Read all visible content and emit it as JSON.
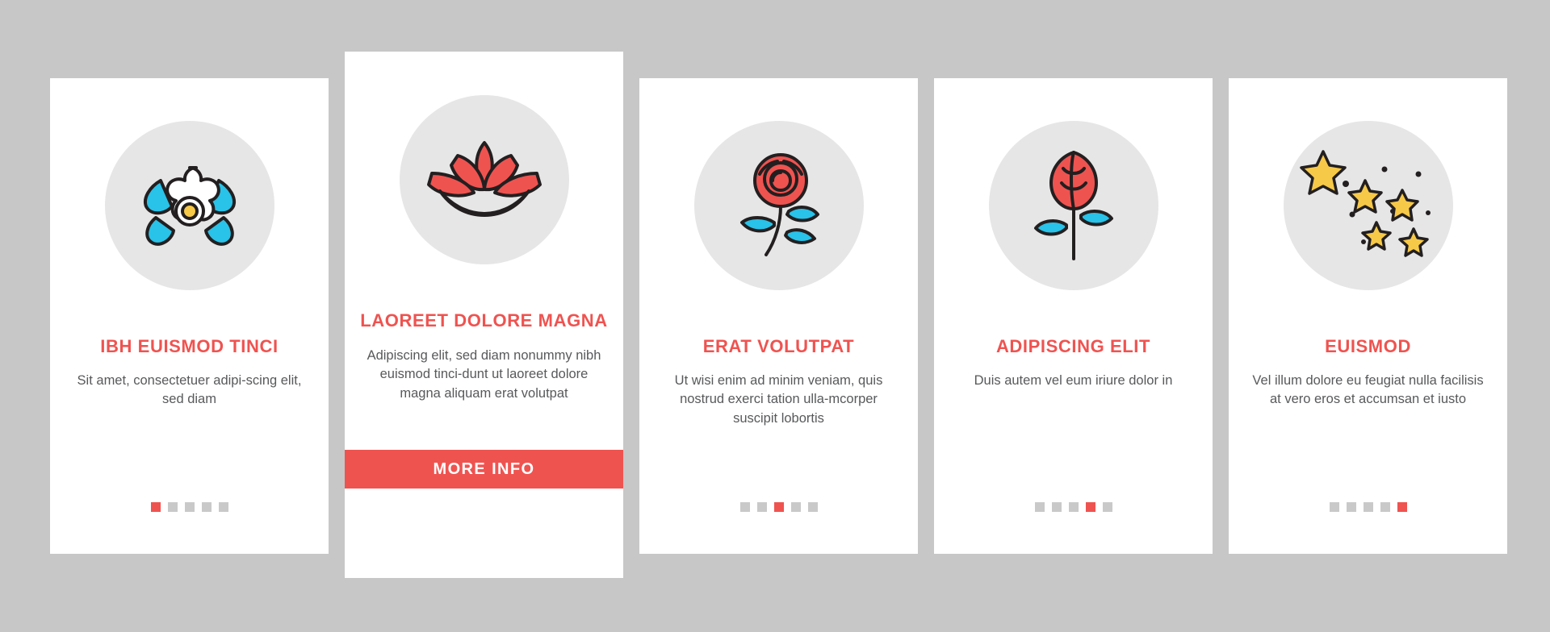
{
  "theme": {
    "background": "#c7c7c7",
    "card_background": "#ffffff",
    "accent": "#ef5350",
    "icon_circle": "#e6e6e6",
    "body_text": "#58595b",
    "dot_inactive": "#c9c9c9",
    "icon_yellow": "#f7c948",
    "icon_cyan": "#29c2e8",
    "icon_dark": "#231f20"
  },
  "cards": [
    {
      "id": "card-1",
      "icon": "flowers-icon",
      "title": "IBH EUISMOD TINCI",
      "body": "Sit amet, consectetuer adipi-scing elit, sed diam",
      "dots": {
        "count": 5,
        "active_index": 0
      },
      "featured": false
    },
    {
      "id": "card-2",
      "icon": "lotus-icon",
      "title": "LAOREET DOLORE MAGNA",
      "body": "Adipiscing elit, sed diam nonummy nibh euismod tinci-dunt ut laoreet dolore magna aliquam erat volutpat",
      "cta_label": "MORE INFO",
      "featured": true
    },
    {
      "id": "card-3",
      "icon": "rose-branch-icon",
      "title": "ERAT VOLUTPAT",
      "body": "Ut wisi enim ad minim veniam, quis nostrud exerci tation ulla-mcorper suscipit lobortis",
      "dots": {
        "count": 5,
        "active_index": 2
      },
      "featured": false
    },
    {
      "id": "card-4",
      "icon": "rosebud-icon",
      "title": "ADIPISCING ELIT",
      "body": "Duis autem vel eum iriure dolor in",
      "dots": {
        "count": 5,
        "active_index": 3
      },
      "featured": false
    },
    {
      "id": "card-5",
      "icon": "sparkles-icon",
      "title": "EUISMOD",
      "body": "Vel illum dolore eu feugiat nulla facilisis at vero eros et accumsan et iusto",
      "dots": {
        "count": 5,
        "active_index": 4
      },
      "featured": false
    }
  ]
}
